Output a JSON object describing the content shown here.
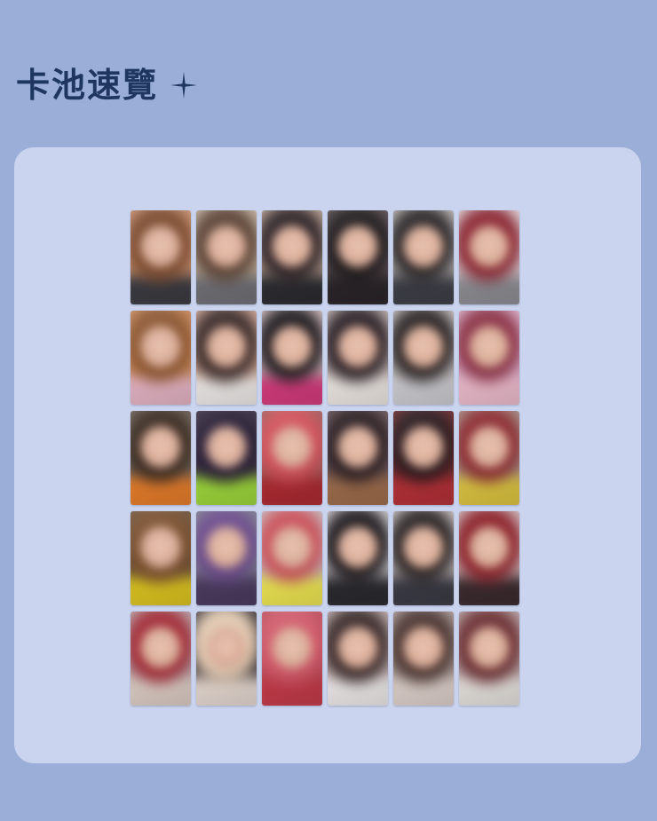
{
  "header": {
    "title": "卡池速覽",
    "sparkle_icon": "sparkle-icon",
    "title_color": "#1e3660"
  },
  "colors": {
    "background": "#9aaed8",
    "panel": "#cbd4ee"
  },
  "gallery": {
    "columns": 6,
    "rows": 5,
    "cards": [
      {
        "bg": "#c79070",
        "hair": "#7a4a2e",
        "top": "#3a3a40"
      },
      {
        "bg": "#bfae9c",
        "hair": "#5a4234",
        "top": "#6e6e74"
      },
      {
        "bg": "#b39b8c",
        "hair": "#2c2226",
        "top": "#2b2b30"
      },
      {
        "bg": "#5a4e52",
        "hair": "#1e1a1c",
        "top": "#2a2428"
      },
      {
        "bg": "#b7b2b0",
        "hair": "#2a2628",
        "top": "#3c3e46"
      },
      {
        "bg": "#d8ccd0",
        "hair": "#8a2632",
        "top": "#8a8a90"
      },
      {
        "bg": "#c8885a",
        "hair": "#8a5530",
        "top": "#e0b0c0"
      },
      {
        "bg": "#c8a090",
        "hair": "#3a2a28",
        "top": "#e8e4e2"
      },
      {
        "bg": "#c8b4b6",
        "hair": "#1e1a1e",
        "top": "#d03a7a"
      },
      {
        "bg": "#b8aca8",
        "hair": "#2a2026",
        "top": "#e8e2de"
      },
      {
        "bg": "#c0b8b8",
        "hair": "#2a2424",
        "top": "#c8c8cc"
      },
      {
        "bg": "#d6a8c4",
        "hair": "#8a3246",
        "top": "#e8b8c8"
      },
      {
        "bg": "#6a6058",
        "hair": "#3a2a20",
        "top": "#e07a2a"
      },
      {
        "bg": "#3a3042",
        "hair": "#2a2036",
        "top": "#9ad23a"
      },
      {
        "bg": "#9e5a58",
        "hair": "#d0505a",
        "top": "#a82a30"
      },
      {
        "bg": "#6a5456",
        "hair": "#2a1e22",
        "top": "#9a6a4a"
      },
      {
        "bg": "#6a2a2c",
        "hair": "#2a1a1e",
        "top": "#b03036"
      },
      {
        "bg": "#a08a82",
        "hair": "#8a2a30",
        "top": "#d8c040"
      },
      {
        "bg": "#6a5038",
        "hair": "#7a5030",
        "top": "#d8c020"
      },
      {
        "bg": "#7a7a8c",
        "hair": "#6a4a8a",
        "top": "#4a3a5e"
      },
      {
        "bg": "#c0b2b4",
        "hair": "#c8505a",
        "top": "#e8e050"
      },
      {
        "bg": "#c8c2c4",
        "hair": "#1e1a1e",
        "top": "#2a2a2e"
      },
      {
        "bg": "#c2b8b8",
        "hair": "#2a2424",
        "top": "#3a3a44"
      },
      {
        "bg": "#c8b2b4",
        "hair": "#8a2028",
        "top": "#3a2a2e"
      },
      {
        "bg": "#b09ca0",
        "hair": "#a02a36",
        "top": "#d8c8c0"
      },
      {
        "bg": "#3a3236",
        "hair": "#e0c8b0",
        "top": "#e0d4cc"
      },
      {
        "bg": "#b84a58",
        "hair": "#d05a6a",
        "top": "#c03a48"
      },
      {
        "bg": "#bca8a8",
        "hair": "#3a2a2a",
        "top": "#e8e4e4"
      },
      {
        "bg": "#a89a96",
        "hair": "#4a3430",
        "top": "#d8ccc6"
      },
      {
        "bg": "#b4a0a0",
        "hair": "#6a2e32",
        "top": "#e0dcd8"
      }
    ]
  }
}
